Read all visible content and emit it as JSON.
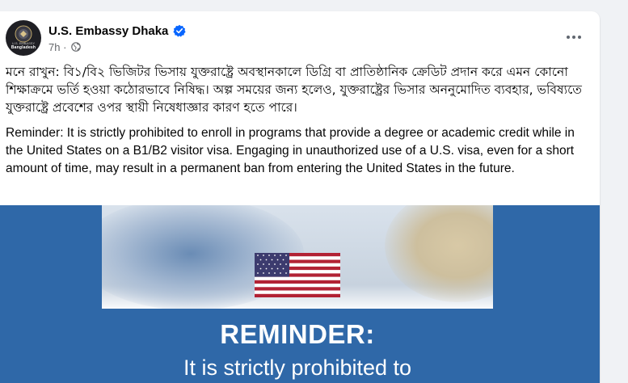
{
  "post": {
    "page_name": "U.S. Embassy Dhaka",
    "time": "7h",
    "separator": "·",
    "avatar_top": "U.S. EMBASSY",
    "avatar_label": "Bangladesh",
    "bengali_text": "মনে রাখুন: বি১/বি২ ভিজিটর ভিসায় যুক্তরাষ্ট্রে অবস্থানকালে ডিগ্রি বা প্রাতিষ্ঠানিক ক্রেডিট প্রদান করে এমন কোনো শিক্ষাক্রমে ভর্তি হওয়া কঠোরভাবে নিষিদ্ধ। অল্প সময়ের জন্য হলেও, যুক্তরাষ্ট্রের ভিসার অননুমোদিত ব্যবহার, ভবিষ্যতে যুক্তরাষ্ট্রে প্রবেশের ওপর স্থায়ী নিষেধাজ্ঞার কারণ হতে পারে।",
    "english_text": "Reminder: It is strictly prohibited to enroll in programs that provide a degree or academic credit while in the United States on a B1/B2 visitor visa. Engaging in unauthorized use of a U.S. visa, even for a short amount of time, may result in a permanent ban from entering the United States in the future.",
    "image_heading": "REMINDER:",
    "image_subtext": "It is strictly prohibited to"
  },
  "icons": {
    "verified": "verified-badge-icon",
    "audience": "globe-icon",
    "more": "more-options-icon",
    "flag": "us-flag-image"
  },
  "colors": {
    "verified_blue": "#0866ff",
    "image_band": "#2f68a8"
  }
}
